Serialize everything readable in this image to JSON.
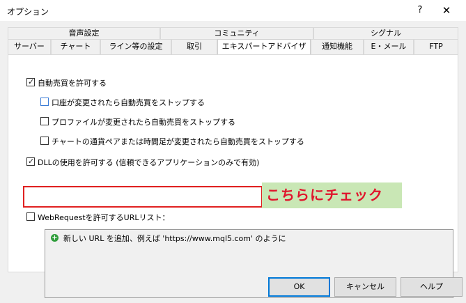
{
  "window": {
    "title": "オプション",
    "help_label": "?",
    "close_label": "✕"
  },
  "tabs_row1": [
    "音声設定",
    "コミュニティ",
    "シグナル"
  ],
  "tabs_row2": [
    "サーバー",
    "チャート",
    "ライン等の設定",
    "取引",
    "エキスパートアドバイザ",
    "通知機能",
    "E・メール",
    "FTP"
  ],
  "options": {
    "auto_trading": {
      "label": "自動売買を許可する",
      "checked": true
    },
    "stop_on_account_change": {
      "label": "口座が変更されたら自動売買をストップする",
      "checked": false
    },
    "stop_on_profile_change": {
      "label": "プロファイルが変更されたら自動売買をストップする",
      "checked": false
    },
    "stop_on_symbol_change": {
      "label": "チャートの通貨ペアまたは時間足が変更されたら自動売買をストップする",
      "checked": false
    },
    "allow_dll": {
      "label": "DLLの使用を許可する (信頼できるアプリケーションのみで有効)",
      "checked": true
    },
    "allow_webrequest": {
      "label": "WebRequestを許可するURLリスト：",
      "checked": false
    }
  },
  "annotation": "こちらにチェック",
  "url_list": {
    "add_hint": "新しい URL を追加、例えば 'https://www.mql5.com' のように"
  },
  "buttons": {
    "ok": "OK",
    "cancel": "キャンセル",
    "help": "ヘルプ"
  },
  "colors": {
    "highlight_border": "#e02020",
    "annotation_bg": "#c9e7b5",
    "annotation_text": "#e0142c",
    "default_button_border": "#0078d7"
  }
}
